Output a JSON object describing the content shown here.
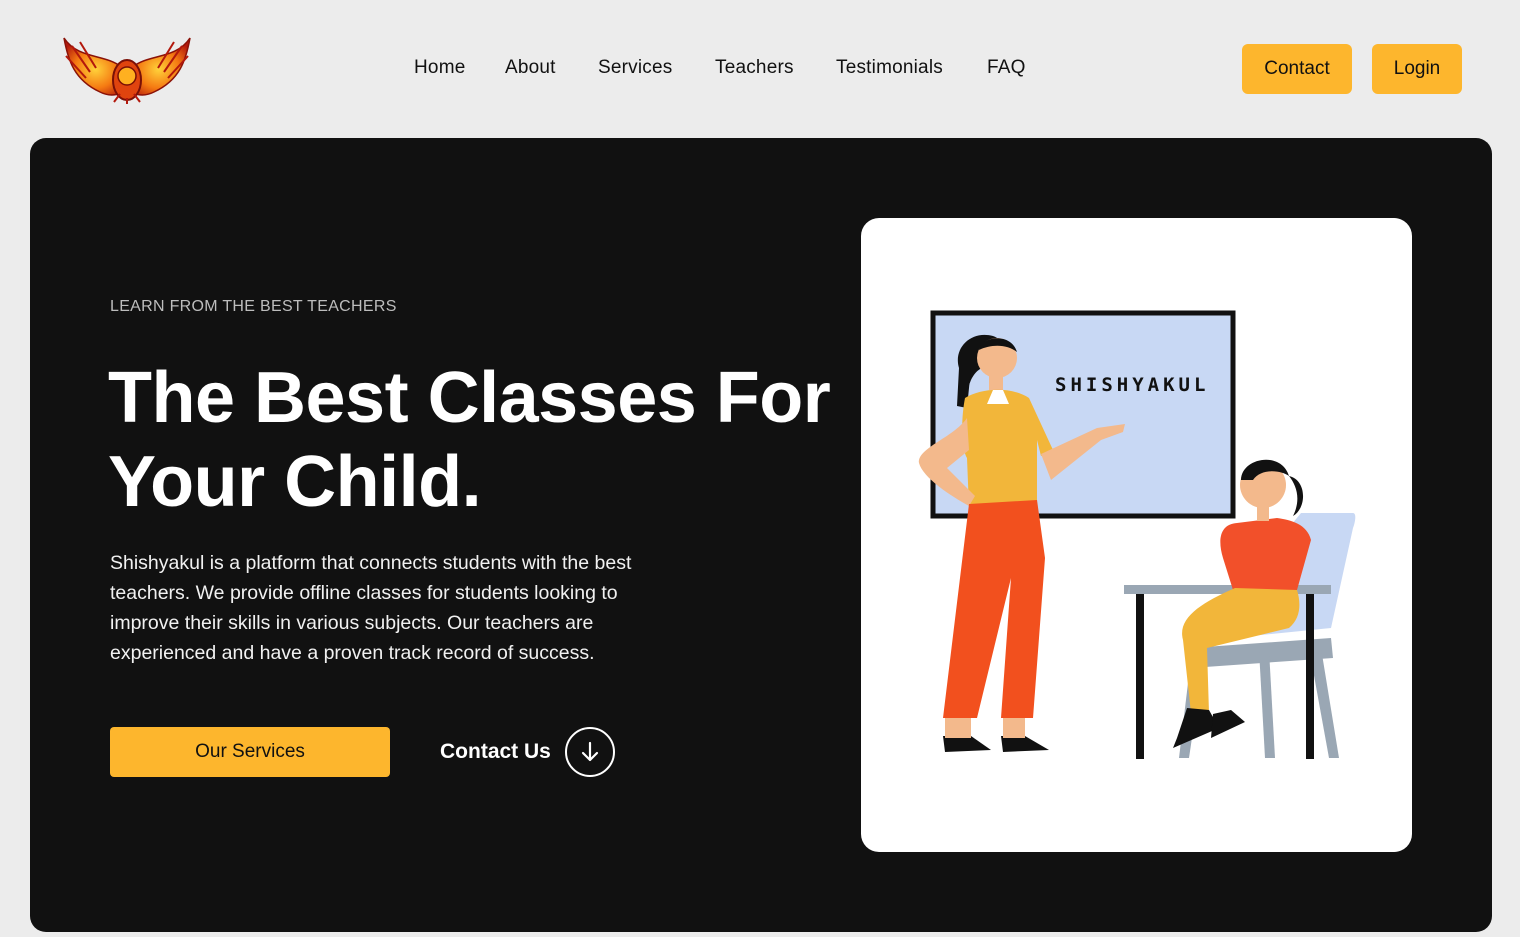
{
  "header": {
    "logo_icon": "phoenix-logo",
    "nav": [
      {
        "label": "Home"
      },
      {
        "label": "About"
      },
      {
        "label": "Services"
      },
      {
        "label": "Teachers"
      },
      {
        "label": "Testimonials"
      },
      {
        "label": "FAQ"
      }
    ],
    "contact_label": "Contact",
    "login_label": "Login"
  },
  "hero": {
    "eyebrow": "LEARN FROM THE BEST TEACHERS",
    "headline_line1": "The Best Classes For",
    "headline_line2": "Your Child.",
    "description": "Shishyakul is a platform that connects students with the best teachers. We provide offline classes for students looking to improve their skills in various subjects. Our teachers are experienced and have a proven track record of success.",
    "primary_button": "Our Services",
    "secondary_link": "Contact Us",
    "secondary_icon": "arrow-down-icon"
  },
  "illustration": {
    "board_text": "SHISHYAKUL"
  },
  "colors": {
    "accent": "#fdb62d",
    "hero_bg": "#111111",
    "page_bg": "#ececec"
  }
}
